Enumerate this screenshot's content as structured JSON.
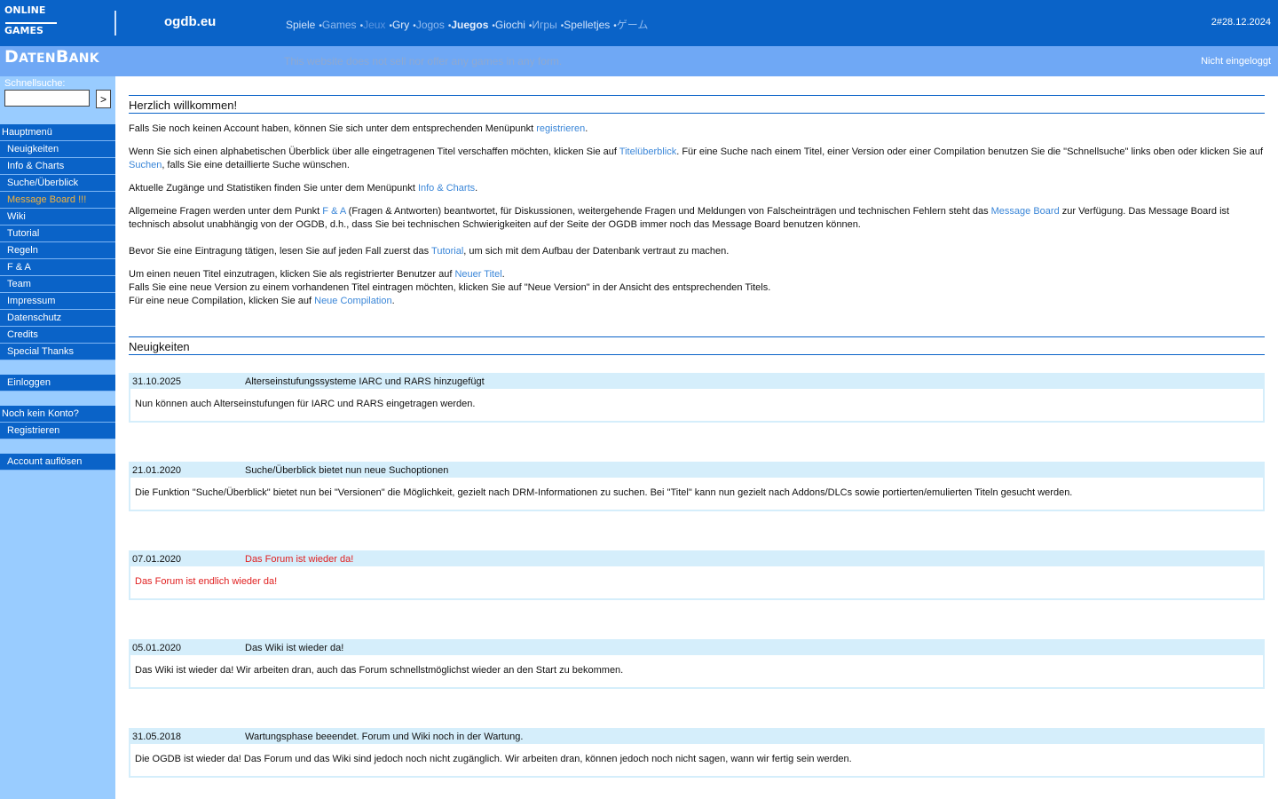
{
  "header": {
    "logo_line1_cap": "O",
    "logo_line1_rest": "NLINE",
    "logo_line2_cap": "G",
    "logo_line2_rest": "AMES",
    "logo_line3_cap_a": "D",
    "logo_line3_rest_a": "ATEN",
    "logo_line3_cap_b": "B",
    "logo_line3_rest_b": "ANK",
    "site_name": "ogdb.eu",
    "languages": [
      {
        "label": "Spiele",
        "color": "#cfe1fa",
        "bold": false
      },
      {
        "label": "Games",
        "color": "#8fb9ee",
        "bold": false
      },
      {
        "label": "Jeux",
        "color": "#5b95e0",
        "bold": false
      },
      {
        "label": "Gry",
        "color": "#e6eefb",
        "bold": false
      },
      {
        "label": "Jogos",
        "color": "#8fb9ee",
        "bold": false
      },
      {
        "label": "Juegos",
        "color": "#e6eefb",
        "bold": true
      },
      {
        "label": "Giochi",
        "color": "#cfe1fa",
        "bold": false
      },
      {
        "label": "Игры",
        "color": "#8fb9ee",
        "bold": false
      },
      {
        "label": "Spelletjes",
        "color": "#cfe1fa",
        "bold": false
      },
      {
        "label": "ゲーム",
        "color": "#8fb9ee",
        "bold": false
      }
    ],
    "separator": "•",
    "date": "2#28.12.2024",
    "disclaimer": "This website does not sell nor offer any games in any form.",
    "login_status": "Nicht eingeloggt"
  },
  "sidebar": {
    "quicksearch_label": "Schnellsuche:",
    "quicksearch_value": "",
    "quicksearch_button": ">",
    "main_menu": [
      {
        "label": "Hauptmenü",
        "head": true
      },
      {
        "label": "Neuigkeiten"
      },
      {
        "label": "Info & Charts"
      },
      {
        "label": "Suche/Überblick"
      },
      {
        "label": "Message Board !!!",
        "highlight": true
      },
      {
        "label": "Wiki"
      },
      {
        "label": "Tutorial"
      },
      {
        "label": "Regeln"
      },
      {
        "label": "F & A"
      },
      {
        "label": "Team"
      },
      {
        "label": "Impressum"
      },
      {
        "label": "Datenschutz"
      },
      {
        "label": "Credits"
      },
      {
        "label": "Special Thanks"
      }
    ],
    "login": "Einloggen",
    "no_account": "Noch kein Konto?",
    "register": "Registrieren",
    "delete_account": "Account auflösen"
  },
  "welcome": {
    "title": "Herzlich willkommen!",
    "p1_a": "Falls Sie noch keinen Account haben, können Sie sich unter dem entsprechenden Menüpunkt ",
    "p1_link": "registrieren",
    "p1_b": ".",
    "p2_a": "Wenn Sie sich einen alphabetischen Überblick über alle eingetragenen Titel verschaffen möchten, klicken Sie auf ",
    "p2_link1": "Titelüberblick",
    "p2_b": ". Für eine Suche nach einem Titel, einer Version oder einer Compilation benutzen Sie die \"Schnellsuche\" links oben oder klicken Sie auf ",
    "p2_link2": "Suchen",
    "p2_c": ", falls Sie eine detaillierte Suche wünschen.",
    "p3_a": "Aktuelle Zugänge und Statistiken finden Sie unter dem Menüpunkt ",
    "p3_link": "Info & Charts",
    "p3_b": ".",
    "p4_a": "Allgemeine Fragen werden unter dem Punkt ",
    "p4_link1": "F & A",
    "p4_b": " (Fragen & Antworten) beantwortet, für Diskussionen, weitergehende Fragen und Meldungen von Falscheinträgen und technischen Fehlern steht das ",
    "p4_link2": "Message Board",
    "p4_c": " zur Verfügung. Das Message Board ist technisch absolut unabhängig von der OGDB, d.h., dass Sie bei technischen Schwierigkeiten auf der Seite der OGDB immer noch das Message Board benutzen können.",
    "p5_a": "Bevor Sie eine Eintragung tätigen, lesen Sie auf jeden Fall zuerst das ",
    "p5_link": "Tutorial",
    "p5_b": ", um sich mit dem Aufbau der Datenbank vertraut zu machen.",
    "p6_a": "Um einen neuen Titel einzutragen, klicken Sie als registrierter Benutzer auf ",
    "p6_link": "Neuer Titel",
    "p6_b": ".",
    "p6_line2": "Falls Sie eine neue Version zu einem vorhandenen Titel eintragen möchten, klicken Sie auf \"Neue Version\" in der Ansicht des entsprechenden Titels.",
    "p6_line3_a": "Für eine neue Compilation, klicken Sie auf ",
    "p6_link3": "Neue Compilation",
    "p6_line3_b": "."
  },
  "news": {
    "title": "Neuigkeiten",
    "items": [
      {
        "date": "31.10.2025",
        "title": "Alterseinstufungssysteme IARC und RARS hinzugefügt",
        "body": "Nun können auch Alterseinstufungen für IARC und RARS eingetragen werden.",
        "red": false
      },
      {
        "date": "21.01.2020",
        "title": "Suche/Überblick bietet nun neue Suchoptionen",
        "body": "Die Funktion \"Suche/Überblick\" bietet nun bei \"Versionen\" die Möglichkeit, gezielt nach DRM-Informationen zu suchen. Bei \"Titel\" kann nun gezielt nach Addons/DLCs sowie portierten/emulierten Titeln gesucht werden.",
        "red": false
      },
      {
        "date": "07.01.2020",
        "title": "Das Forum ist wieder da!",
        "body": "Das Forum ist endlich wieder da!",
        "red": true
      },
      {
        "date": "05.01.2020",
        "title": "Das Wiki ist wieder da!",
        "body": "Das Wiki ist wieder da! Wir arbeiten dran, auch das Forum schnellstmöglichst wieder an den Start zu bekommen.",
        "red": false
      },
      {
        "date": "31.05.2018",
        "title": "Wartungsphase beeendet. Forum und Wiki noch in der Wartung.",
        "body": "Die OGDB ist wieder da! Das Forum und das Wiki sind jedoch noch nicht zugänglich. Wir arbeiten dran, können jedoch noch nicht sagen, wann wir fertig sein werden.",
        "red": false
      }
    ]
  }
}
